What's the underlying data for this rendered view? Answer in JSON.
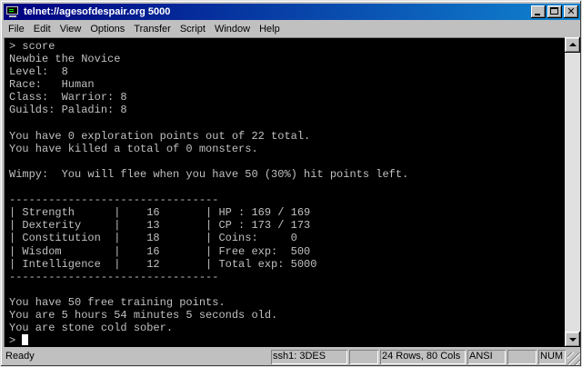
{
  "window": {
    "title": "telnet://agesofdespair.org 5000",
    "icon": "terminal-icon"
  },
  "menu": [
    "File",
    "Edit",
    "View",
    "Options",
    "Transfer",
    "Script",
    "Window",
    "Help"
  ],
  "terminal": {
    "lines": [
      "> score",
      "Newbie the Novice",
      "Level:  8",
      "Race:   Human",
      "Class:  Warrior: 8",
      "Guilds: Paladin: 8",
      "",
      "You have 0 exploration points out of 22 total.",
      "You have killed a total of 0 monsters.",
      "",
      "Wimpy:  You will flee when you have 50 (30%) hit points left.",
      "",
      "--------------------------------",
      "| Strength      |    16       | HP : 169 / 169",
      "| Dexterity     |    13       | CP : 173 / 173",
      "| Constitution  |    18       | Coins:     0",
      "| Wisdom        |    16       | Free exp:  500",
      "| Intelligence  |    12       | Total exp: 5000",
      "--------------------------------",
      "",
      "You have 50 free training points.",
      "You are 5 hours 54 minutes 5 seconds old.",
      "You are stone cold sober."
    ],
    "prompt": "> ",
    "colors": {
      "background": "#000000",
      "foreground": "#c0c0c0"
    }
  },
  "status": {
    "ready": "Ready",
    "encryption": "ssh1: 3DES",
    "empty": "",
    "size": "24 Rows,  80 Cols",
    "emulation": "ANSI",
    "empty2": "",
    "num": "NUM"
  }
}
